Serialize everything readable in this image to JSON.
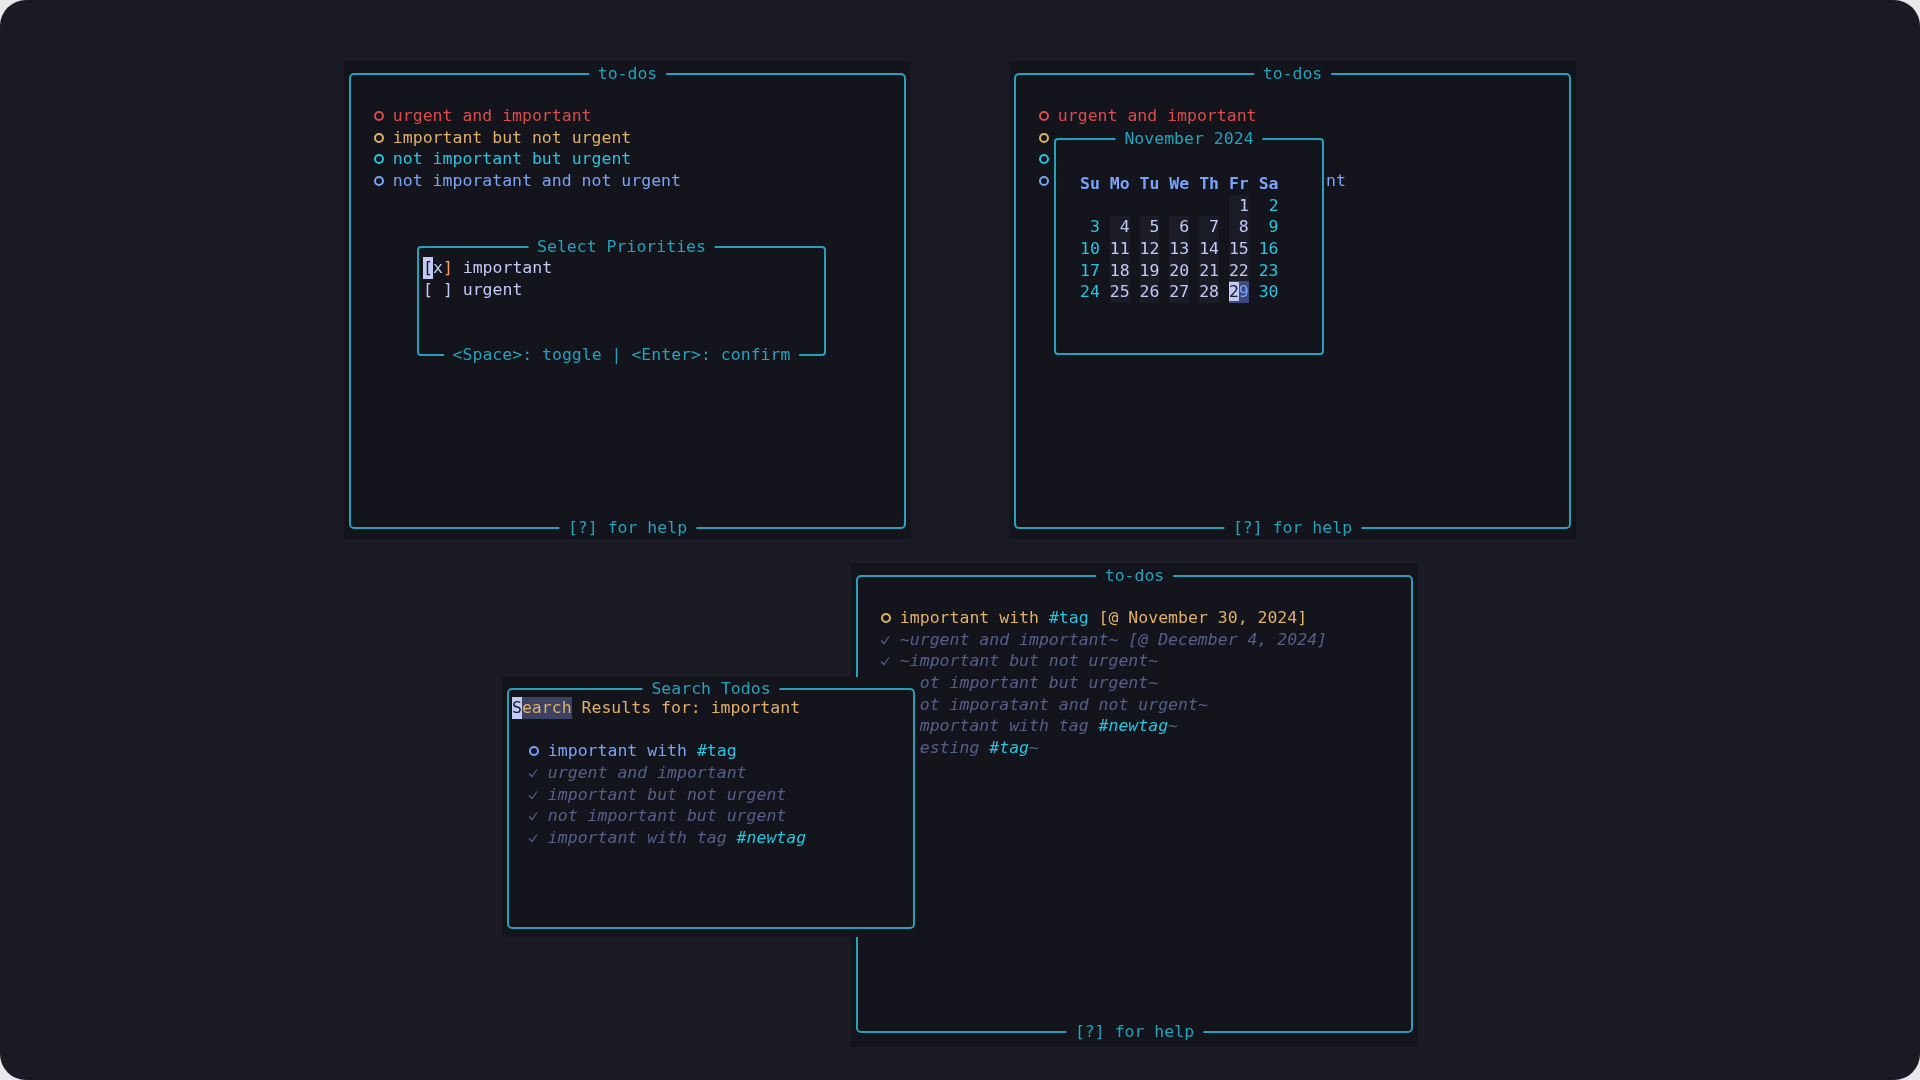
{
  "priority_window": {
    "title": "to-dos",
    "footer": "[?] for help",
    "todos": [
      {
        "text": "urgent and important",
        "color": "#db4b4b"
      },
      {
        "text": "important but not urgent",
        "color": "#e0af68"
      },
      {
        "text": "not important but urgent",
        "color": "#2ac3de"
      },
      {
        "text": "not imporatant and not urgent",
        "color": "#7aa2f7"
      }
    ],
    "dialog": {
      "title": "Select Priorities",
      "hint": "<Space>: toggle | <Enter>: confirm",
      "options": [
        {
          "mark": "[x]",
          "label": "important",
          "selected": true
        },
        {
          "mark": "[ ]",
          "label": "urgent",
          "selected": false
        }
      ]
    }
  },
  "calendar_window": {
    "title": "to-dos",
    "footer": "[?] for help",
    "todos": [
      {
        "kind": "full",
        "text": "urgent and important",
        "color": "#db4b4b"
      },
      {
        "kind": "hidden",
        "color": "#e0af68"
      },
      {
        "kind": "hidden",
        "color": "#2ac3de"
      },
      {
        "kind": "cut",
        "text": "nt",
        "color": "#7aa2f7"
      }
    ],
    "calendar": {
      "title": "November 2024",
      "weekdays": [
        "Su",
        "Mo",
        "Tu",
        "We",
        "Th",
        "Fr",
        "Sa"
      ],
      "weeks": [
        {
          "kind": "partial",
          "days": [
            {
              "day": "1",
              "selected": false
            },
            {
              "day": "2",
              "selected": false
            }
          ]
        },
        {
          "days": [
            {
              "day": "3",
              "selected": false
            },
            {
              "day": "4",
              "selected": false
            },
            {
              "day": "5",
              "selected": false
            },
            {
              "day": "6",
              "selected": false
            },
            {
              "day": "7",
              "selected": false
            },
            {
              "day": "8",
              "selected": false
            },
            {
              "day": "9",
              "selected": false
            }
          ]
        },
        {
          "days": [
            {
              "day": "10",
              "selected": false
            },
            {
              "day": "11",
              "selected": false
            },
            {
              "day": "12",
              "selected": false
            },
            {
              "day": "13",
              "selected": false
            },
            {
              "day": "14",
              "selected": false
            },
            {
              "day": "15",
              "selected": false
            },
            {
              "day": "16",
              "selected": false
            }
          ]
        },
        {
          "days": [
            {
              "day": "17",
              "selected": false
            },
            {
              "day": "18",
              "selected": false
            },
            {
              "day": "19",
              "selected": false
            },
            {
              "day": "20",
              "selected": false
            },
            {
              "day": "21",
              "selected": false
            },
            {
              "day": "22",
              "selected": false
            },
            {
              "day": "23",
              "selected": false
            }
          ]
        },
        {
          "days": [
            {
              "day": "24",
              "selected": false
            },
            {
              "day": "25",
              "selected": false
            },
            {
              "day": "26",
              "selected": false
            },
            {
              "day": "27",
              "selected": false
            },
            {
              "day": "28",
              "selected": false
            },
            {
              "day": "29",
              "selected": true
            },
            {
              "day": "30",
              "selected": false
            }
          ]
        }
      ]
    }
  },
  "list_window": {
    "title": "to-dos",
    "footer": "[?] for help",
    "items": [
      {
        "kind": "full",
        "done": false,
        "color": "#e0af68",
        "segments": [
          {
            "text": "important with "
          },
          {
            "text": "#tag",
            "kind": "tag"
          },
          {
            "text": " [@ November 30, 2024]"
          }
        ]
      },
      {
        "kind": "full",
        "done": true,
        "segments": [
          {
            "text": "~urgent and important~ [@ December 4, 2024]"
          }
        ]
      },
      {
        "kind": "full",
        "done": true,
        "segments": [
          {
            "text": "~important but not urgent~"
          }
        ]
      },
      {
        "kind": "cut",
        "done": true,
        "segments": [
          {
            "text": "ot important but urgent~"
          }
        ]
      },
      {
        "kind": "cut",
        "done": true,
        "segments": [
          {
            "text": "ot imporatant and not urgent~"
          }
        ]
      },
      {
        "kind": "cut",
        "done": true,
        "segments": [
          {
            "text": "mportant with tag "
          },
          {
            "text": "#newtag",
            "kind": "tag"
          },
          {
            "text": "~"
          }
        ]
      },
      {
        "kind": "cut",
        "done": true,
        "segments": [
          {
            "text": "esting "
          },
          {
            "text": "#tag",
            "kind": "tag"
          },
          {
            "text": "~"
          }
        ]
      }
    ],
    "search": {
      "title": "Search Todos",
      "heading": [
        {
          "text": "S",
          "kind": "cursor"
        },
        {
          "text": "earch",
          "kind": "match"
        },
        {
          "text": " Results for: important"
        }
      ],
      "results": [
        {
          "done": false,
          "color": "#7aa2f7",
          "segments": [
            {
              "text": "important with "
            },
            {
              "text": "#tag",
              "kind": "tag"
            }
          ]
        },
        {
          "done": true,
          "segments": [
            {
              "text": "urgent and important"
            }
          ]
        },
        {
          "done": true,
          "segments": [
            {
              "text": "important but not urgent"
            }
          ]
        },
        {
          "done": true,
          "segments": [
            {
              "text": "not important but urgent"
            }
          ]
        },
        {
          "done": true,
          "segments": [
            {
              "text": "important with tag "
            },
            {
              "text": "#newtag",
              "kind": "tag"
            }
          ]
        }
      ]
    }
  }
}
